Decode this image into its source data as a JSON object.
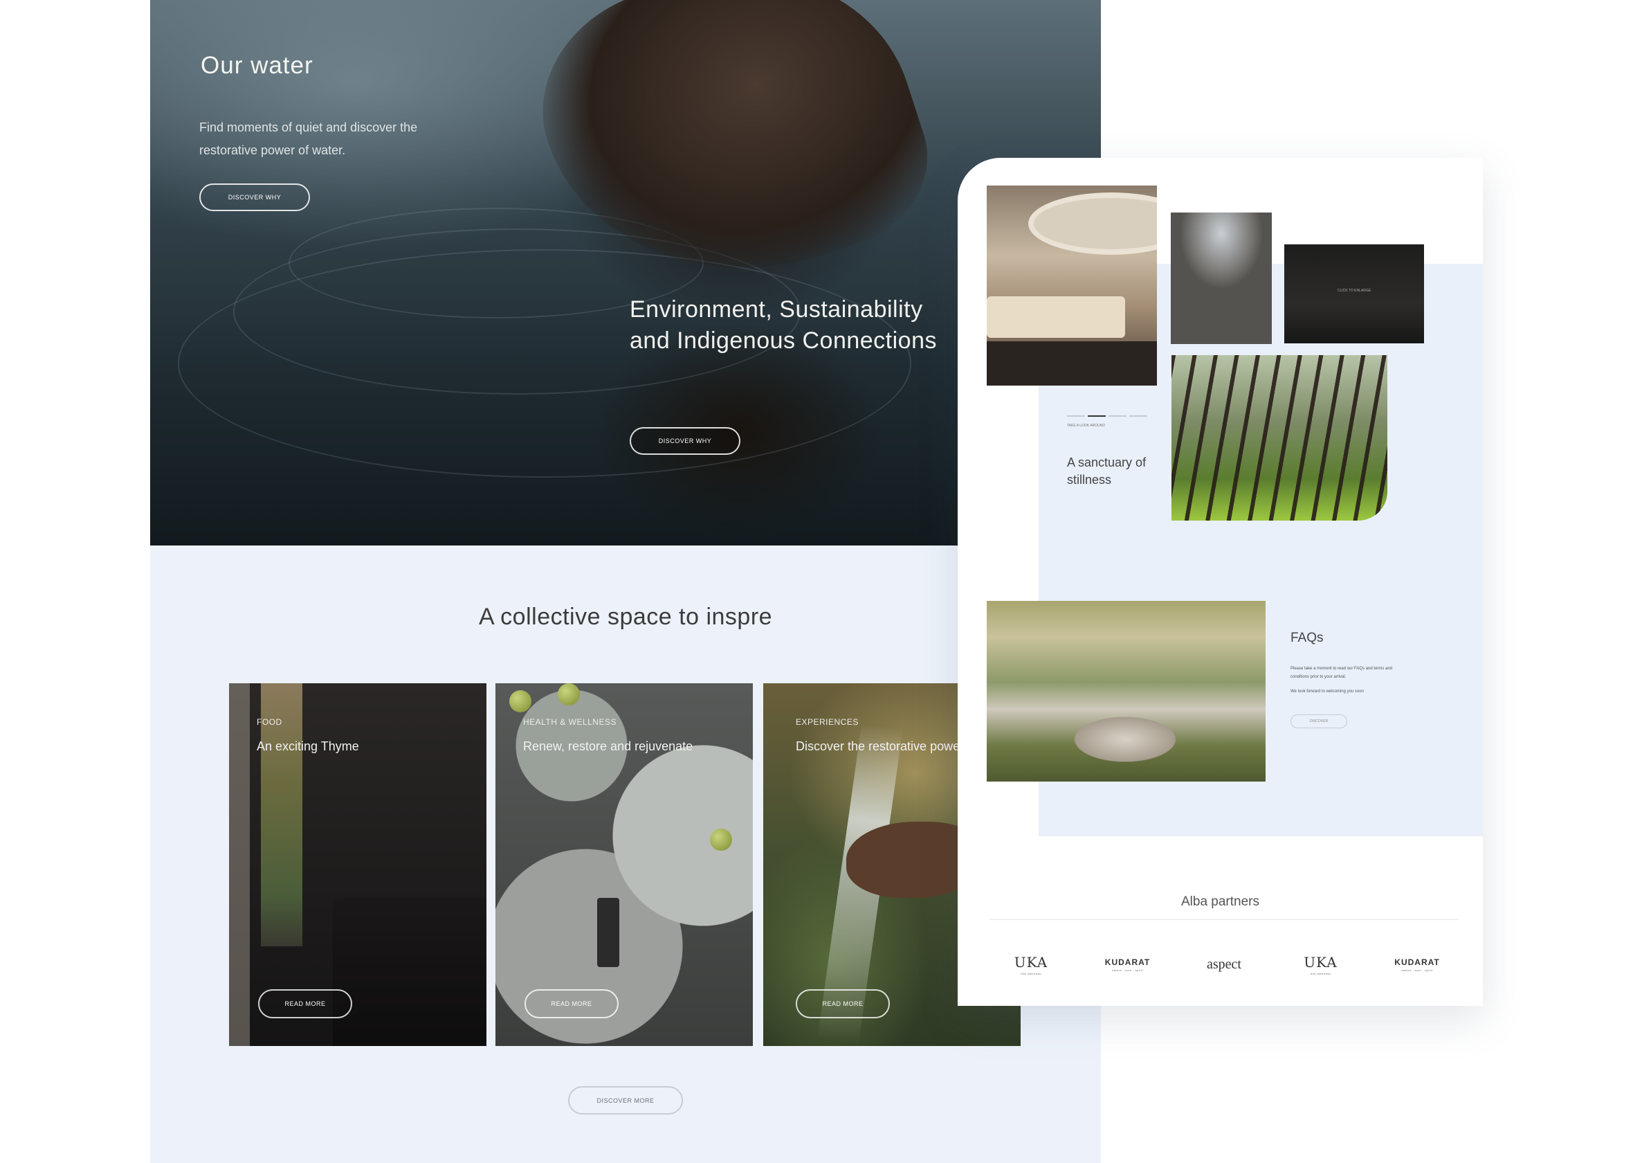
{
  "hero": {
    "title": "Our water",
    "description": "Find moments of quiet and discover the restorative power of water.",
    "button1": "DISCOVER WHY",
    "subtitle": "Environment, Sustainability and Indigenous Connections",
    "button2": "DISCOVER WHY"
  },
  "collective": {
    "title": "A collective space to inspre",
    "cards": [
      {
        "category": "FOOD",
        "headline": "An exciting Thyme",
        "button": "READ MORE"
      },
      {
        "category": "HEALTH & WELLNESS",
        "headline": "Renew, restore and rejuvenate",
        "button": "READ MORE"
      },
      {
        "category": "EXPERIENCES",
        "headline": "Discover the restorative power of water",
        "button": "READ MORE"
      }
    ],
    "discover_more": "DISCOVER MORE"
  },
  "right_page": {
    "enlarge_label": "CLICK TO ENLARGE",
    "look_around": "TAKE A LOOK AROUND",
    "sanctuary": "A sanctuary of stillness",
    "faqs": {
      "title": "FAQs",
      "text": "Please take a moment to read our FAQs and terms and conditions prior to your arrival.",
      "text2": "We look forward to welcoming you soon",
      "button": "DISCOVER"
    },
    "partners": {
      "title": "Alba partners",
      "logos": [
        {
          "name": "UKA",
          "sub": "fine wellness"
        },
        {
          "name": "KUDARAT",
          "sub": "nature · soul · spirit"
        },
        {
          "name": "aspect",
          "sub": ""
        },
        {
          "name": "UKA",
          "sub": "fine wellness"
        },
        {
          "name": "KUDARAT",
          "sub": "nature · soul · spirit"
        }
      ]
    }
  },
  "colors": {
    "page_bg": "#edf2fa",
    "accent_bg": "#e9f0fa",
    "text_dark": "#444444"
  }
}
